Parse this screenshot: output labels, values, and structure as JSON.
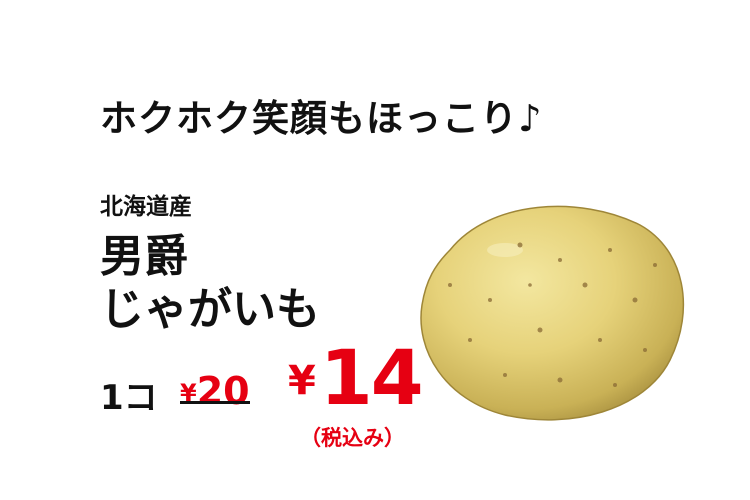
{
  "tagline": "ホクホク笑顔もほっこり♪",
  "product": {
    "origin": "北海道産",
    "name_line1": "男爵",
    "name_line2": "じゃがいも",
    "image_icon": "potato-image"
  },
  "pricing": {
    "quantity": "1コ",
    "old_yen": "¥",
    "old_value": "20",
    "new_yen": "¥",
    "new_value": "14",
    "tax_note": "（税込み）"
  },
  "colors": {
    "price_red": "#e60012",
    "text": "#111111",
    "potato_skin": "#e6d27a"
  }
}
